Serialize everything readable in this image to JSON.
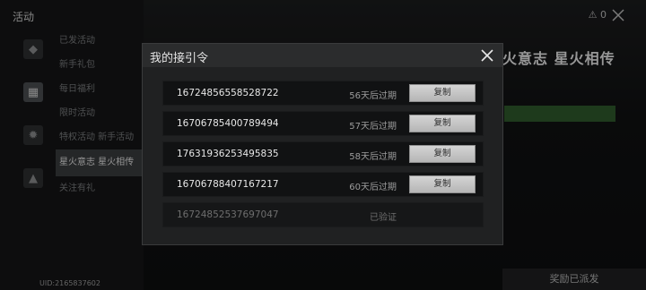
{
  "background": {
    "title": "活动",
    "menu": [
      "已发活动",
      "新手礼包",
      "每日福利",
      "限时活动",
      "特权活动 新手活动",
      "星火意志 星火相传",
      "关注有礼"
    ],
    "selected_index": 5,
    "banner": "火意志 星火相传",
    "reward_button": "奖励已派发",
    "uid": "UID:2165837602",
    "top_status": "⚠ 0"
  },
  "modal": {
    "title": "我的接引令",
    "rows": [
      {
        "code": "16724856558528722",
        "status": "56天后过期",
        "action": "复制",
        "used": false
      },
      {
        "code": "16706785400789494",
        "status": "57天后过期",
        "action": "复制",
        "used": false
      },
      {
        "code": "17631936253495835",
        "status": "58天后过期",
        "action": "复制",
        "used": false
      },
      {
        "code": "16706788407167217",
        "status": "60天后过期",
        "action": "复制",
        "used": false
      },
      {
        "code": "16724852537697047",
        "status": "已验证",
        "action": "",
        "used": true
      }
    ]
  }
}
